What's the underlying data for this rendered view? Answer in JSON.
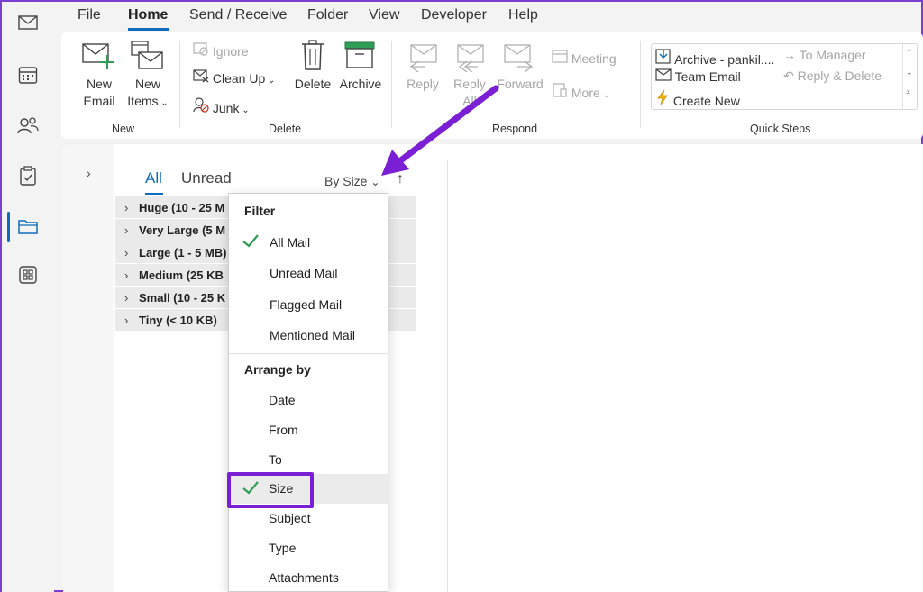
{
  "tabs": [
    "File",
    "Home",
    "Send / Receive",
    "Folder",
    "View",
    "Developer",
    "Help"
  ],
  "left_rail": [
    "mail-icon",
    "calendar-icon",
    "people-icon",
    "tasks-icon",
    "folder-icon",
    "apps-icon"
  ],
  "ribbon": {
    "new_group": {
      "label": "New",
      "new_email": [
        "New",
        "Email"
      ],
      "new_items": [
        "New",
        "Items"
      ]
    },
    "delete_group": {
      "label": "Delete",
      "ignore": "Ignore",
      "clean_up": "Clean Up",
      "junk": "Junk",
      "delete": "Delete",
      "archive": "Archive"
    },
    "respond_group": {
      "label": "Respond",
      "reply": "Reply",
      "reply_all": [
        "Reply",
        "All"
      ],
      "forward": "Forward",
      "meeting": "Meeting",
      "more": "More"
    },
    "quick_steps": {
      "label": "Quick Steps",
      "archive": "Archive - pankil....",
      "team_email": "Team Email",
      "create_new": "Create New",
      "to_manager": "To Manager",
      "reply_delete": "Reply & Delete"
    }
  },
  "list": {
    "filter_tabs": [
      "All",
      "Unread"
    ],
    "sort_label": "By Size",
    "groups": [
      "Huge (10 - 25 M",
      "Very Large (5 M",
      "Large (1 - 5 MB)",
      "Medium (25 KB",
      "Small (10 - 25 K",
      "Tiny (< 10 KB)"
    ]
  },
  "menu": {
    "filter_heading": "Filter",
    "filter_items": [
      "All Mail",
      "Unread Mail",
      "Flagged Mail",
      "Mentioned Mail"
    ],
    "arrange_heading": "Arrange by",
    "arrange_items": [
      "Date",
      "From",
      "To",
      "Size",
      "Subject",
      "Type",
      "Attachments"
    ],
    "checked_filter": "All Mail",
    "checked_arrange": "Size"
  },
  "colors": {
    "accent": "#0f6cbd",
    "check": "#2e9d55",
    "annotation": "#7b1fd4"
  }
}
